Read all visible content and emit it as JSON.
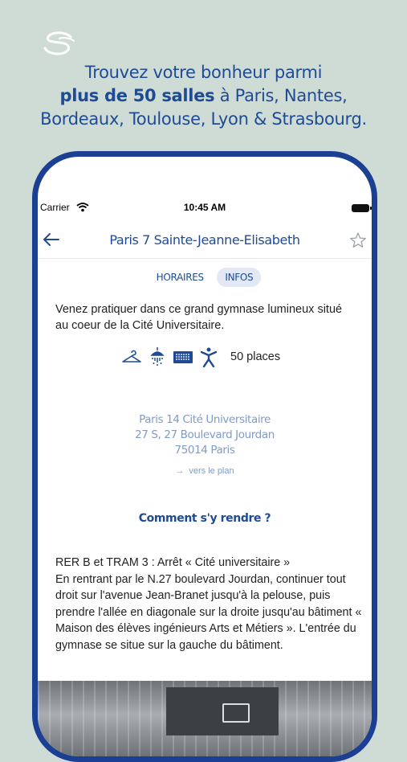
{
  "promo": {
    "line1": "Trouvez votre bonheur parmi",
    "line2_bold": "plus de 50 salles",
    "line2_rest": " à Paris, Nantes,",
    "line3": "Bordeaux, Toulouse, Lyon & Strasbourg."
  },
  "status_bar": {
    "carrier": "Carrier",
    "time": "10:45 AM"
  },
  "navbar": {
    "title": "Paris  7 Sainte-Jeanne-Elisabeth"
  },
  "tabs": [
    {
      "label": "HORAIRES",
      "active": false
    },
    {
      "label": "INFOS",
      "active": true
    }
  ],
  "description": "Venez pratiquer dans ce grand gymnase lumineux situé au coeur de la Cité Universitaire.",
  "amenities": {
    "icons": [
      "hanger-icon",
      "shower-icon",
      "card-reader-icon",
      "person-icon"
    ],
    "places": "50 places"
  },
  "address": {
    "line1": "Paris 14 Cité Universitaire",
    "line2": "27 S, 27 Boulevard Jourdan",
    "line3": "75014 Paris"
  },
  "plan_link": "vers le plan",
  "howto_title": "Comment s'y rendre ?",
  "directions": {
    "line1": "RER B et TRAM 3 : Arrêt « Cité universitaire »",
    "body": "En rentrant par le N.27 boulevard Jourdan, continuer tout droit sur l'avenue Jean-Branet jusqu'à la pelouse, puis prendre l'allée en diagonale sur la droite jusqu'au bâtiment « Maison des élèves ingénieurs Arts et Métiers ». L'entrée du gymnase se situe sur la gauche du bâtiment."
  },
  "colors": {
    "brand": "#1e4b93",
    "background": "#cfdcd6",
    "link": "#7f9bc7"
  }
}
